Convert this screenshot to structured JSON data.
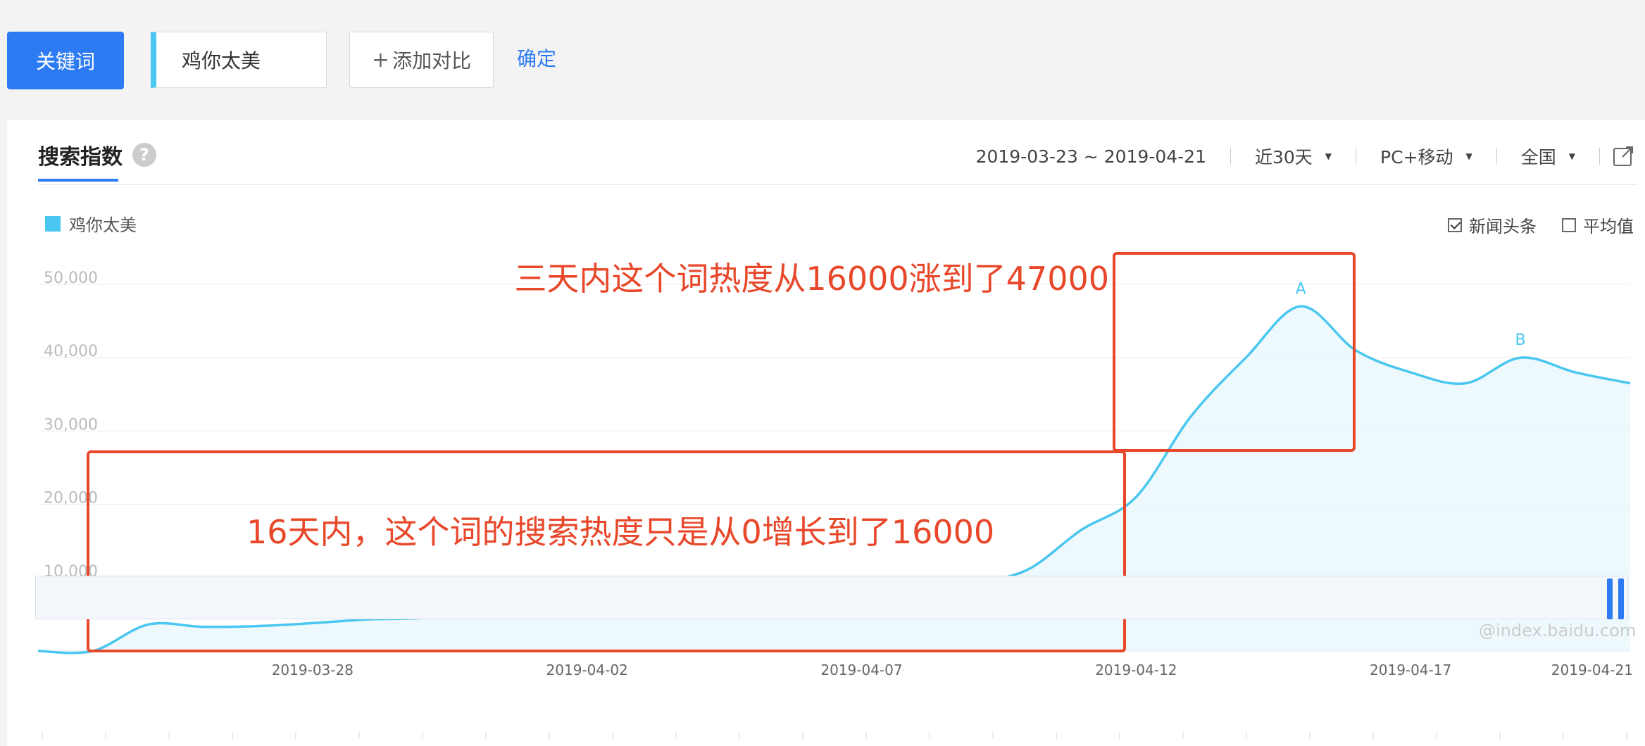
{
  "toolbar": {
    "keyword_button": "关键词",
    "keyword_value": "鸡你太美",
    "add_compare_plus": "+",
    "add_compare_label": "添加对比",
    "confirm_label": "确定"
  },
  "panel": {
    "tab_title": "搜索指数",
    "help_icon": "?",
    "date_range": "2019-03-23 ~ 2019-04-21",
    "period": "近30天",
    "device": "PC+移动",
    "region": "全国",
    "export_icon": "external-link-icon",
    "legend_label": "鸡你太美",
    "checkbox_news": "新闻头条",
    "checkbox_news_checked": true,
    "checkbox_average": "平均值",
    "checkbox_average_checked": false,
    "watermark": "@index.baidu.com"
  },
  "colors": {
    "accent": "#2d7bf2",
    "series": "#4ac7f0",
    "annotation": "#e8472a"
  },
  "chart_data": {
    "type": "area",
    "title": "",
    "xlabel": "",
    "ylabel": "",
    "ylim": [
      0,
      50000
    ],
    "yticks": [
      "50,000",
      "40,000",
      "30,000",
      "20,000",
      "10,000"
    ],
    "xtick_labels": [
      "2019-03-28",
      "2019-04-02",
      "2019-04-07",
      "2019-04-12",
      "2019-04-17",
      "2019-04-21"
    ],
    "grid": true,
    "legend": "top-left",
    "series": [
      {
        "name": "鸡你太美",
        "x": [
          "2019-03-23",
          "2019-03-24",
          "2019-03-25",
          "2019-03-26",
          "2019-03-27",
          "2019-03-28",
          "2019-03-29",
          "2019-03-30",
          "2019-03-31",
          "2019-04-01",
          "2019-04-02",
          "2019-04-03",
          "2019-04-04",
          "2019-04-05",
          "2019-04-06",
          "2019-04-07",
          "2019-04-08",
          "2019-04-09",
          "2019-04-10",
          "2019-04-11",
          "2019-04-12",
          "2019-04-13",
          "2019-04-14",
          "2019-04-15",
          "2019-04-16",
          "2019-04-17",
          "2019-04-18",
          "2019-04-19",
          "2019-04-20",
          "2019-04-21"
        ],
        "values": [
          0,
          0,
          3600,
          3300,
          3400,
          3800,
          4300,
          4500,
          5300,
          5900,
          5800,
          6100,
          5700,
          6300,
          7500,
          8600,
          9800,
          9500,
          11000,
          16500,
          21000,
          32000,
          40000,
          47000,
          41000,
          38000,
          36500,
          40000,
          38000,
          36500
        ]
      }
    ],
    "point_labels": [
      {
        "date": "2019-04-15",
        "text": "A"
      },
      {
        "date": "2019-04-19",
        "text": "B"
      }
    ],
    "annotations": [
      {
        "text": "三天内这个词热度从16000涨到了47000",
        "box_from": "2019-04-13",
        "box_to": "2019-04-16"
      },
      {
        "text": "16天内，这个词的搜索热度只是从0增长到了16000",
        "box_from": "2019-03-24",
        "box_to": "2019-04-13"
      }
    ]
  }
}
